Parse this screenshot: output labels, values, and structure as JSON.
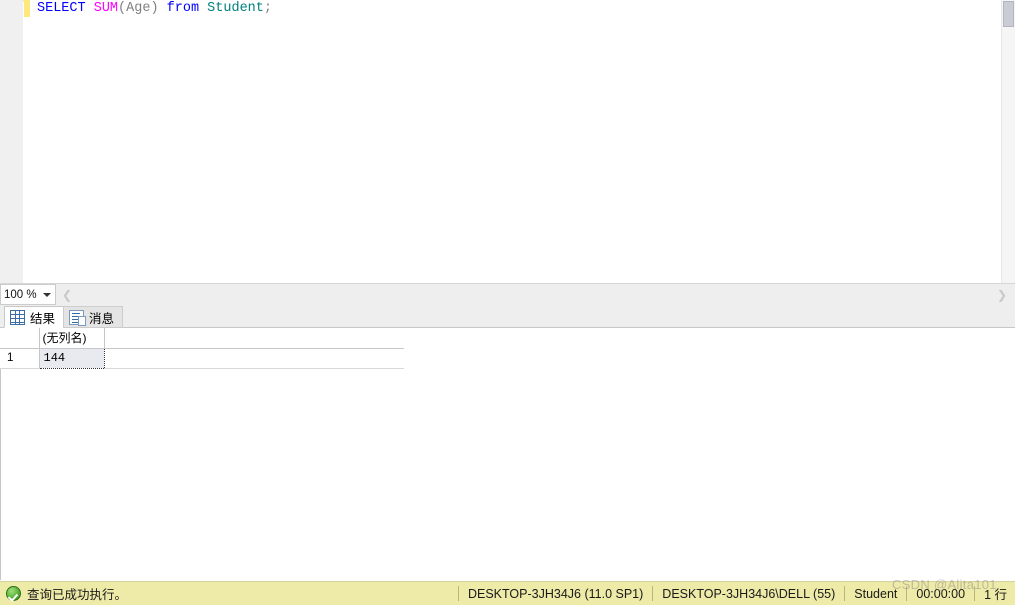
{
  "editor": {
    "zoom_level": "100 %",
    "scroll_left_icon": "chevron-left-icon",
    "scroll_right_icon": "chevron-right-icon",
    "code": {
      "keyword_select": "SELECT ",
      "function_sum": "SUM",
      "paren_open": "(",
      "column_age": "Age",
      "paren_close": ")",
      "keyword_from": " from ",
      "table_student": "Student",
      "semicolon": ";"
    }
  },
  "results": {
    "tabs": [
      {
        "label": "结果",
        "icon": "grid-icon",
        "active": true
      },
      {
        "label": "消息",
        "icon": "message-icon",
        "active": false
      }
    ],
    "grid": {
      "columns": [
        "(无列名)"
      ],
      "rows": [
        {
          "row_number": "1",
          "values": [
            "144"
          ]
        }
      ]
    }
  },
  "statusbar": {
    "status_icon": "success-check-icon",
    "status_message": "查询已成功执行。",
    "server": "DESKTOP-3JH34J6 (11.0 SP1)",
    "user": "DESKTOP-3JH34J6\\DELL (55)",
    "database": "Student",
    "elapsed": "00:00:00",
    "row_count": "1 行"
  },
  "watermark": {
    "text": "CSDN @Alita101"
  }
}
